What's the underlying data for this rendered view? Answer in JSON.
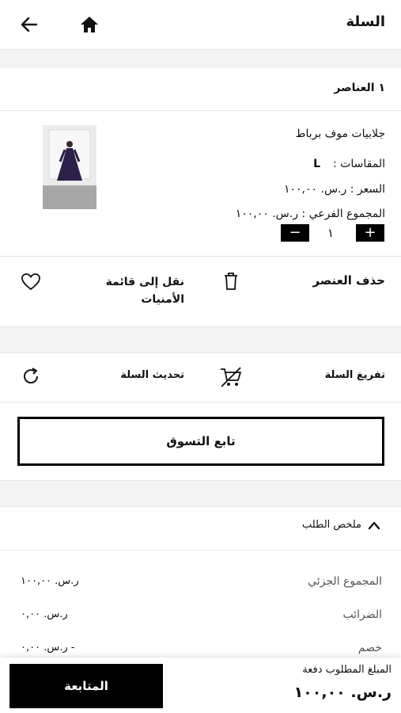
{
  "header": {
    "title": "السلة"
  },
  "cart": {
    "items_count": "١ العناصر",
    "item": {
      "name": "جلابيات موف برباط",
      "size_label": "المقاسات :",
      "size_value": "L",
      "price_text": "السعر : ر.س. ١٠٠,٠٠",
      "subtotal_text": "المجموع الفرعي : ر.س. ١٠٠,٠٠",
      "quantity": "١",
      "plus": "+",
      "minus": "−"
    },
    "actions": {
      "remove_label": "حذف العنصر",
      "wishlist_label_line1": "نقل إلى قائمة",
      "wishlist_label_line2": "الأمنيات"
    },
    "bulk": {
      "empty_label": "تفريغ السلة",
      "update_label": "تحديث السلة"
    },
    "continue_label": "تابع التسوق"
  },
  "summary": {
    "title": "ملخص الطلب",
    "rows": [
      {
        "label": "المجموع الجزئي",
        "value": "ر.س. ١٠٠,٠٠"
      },
      {
        "label": "الضرائب",
        "value": "ر.س. ٠,٠٠"
      },
      {
        "label": "خصم",
        "value": "- ر.س. ٠,٠٠"
      }
    ]
  },
  "footer": {
    "due_label": "المبلغ المطلوب دفعة",
    "due_value": "ر.س. ١٠٠,٠٠",
    "checkout_label": "المتابعة"
  },
  "colors": {
    "accent": "#000000",
    "band": "#f3f3f3",
    "divider": "#e5e5e5",
    "dress": "#2c1f4a"
  },
  "icons": [
    "back-arrow-icon",
    "home-icon",
    "trash-icon",
    "heart-icon",
    "refresh-icon",
    "cart-remove-icon",
    "chevron-up-icon"
  ]
}
